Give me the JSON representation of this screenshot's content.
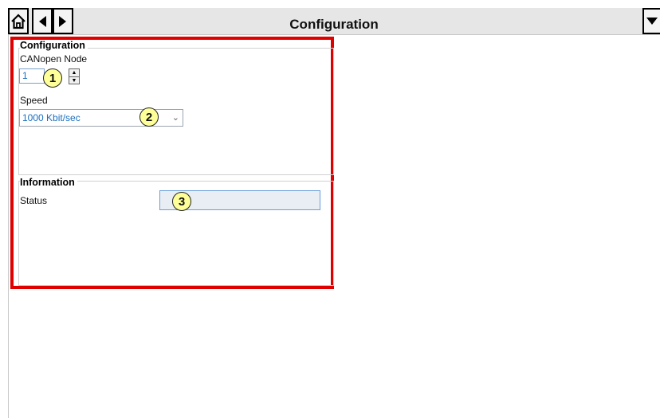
{
  "header": {
    "title": "Configuration",
    "home_icon": "home-icon",
    "back_icon": "back-arrow-icon",
    "forward_icon": "forward-arrow-icon",
    "menu_icon": "dropdown-menu-icon"
  },
  "configuration": {
    "legend": "Configuration",
    "canopen_label": "CANopen Node",
    "canopen_value": "1",
    "speed_label": "Speed",
    "speed_value": "1000 Kbit/sec"
  },
  "information": {
    "legend": "Information",
    "status_label": "Status",
    "status_value": ""
  },
  "callouts": [
    "1",
    "2",
    "3"
  ],
  "colors": {
    "highlight": "#e00000",
    "callout_fill": "#ffff99",
    "value_text": "#1a6fc0"
  }
}
